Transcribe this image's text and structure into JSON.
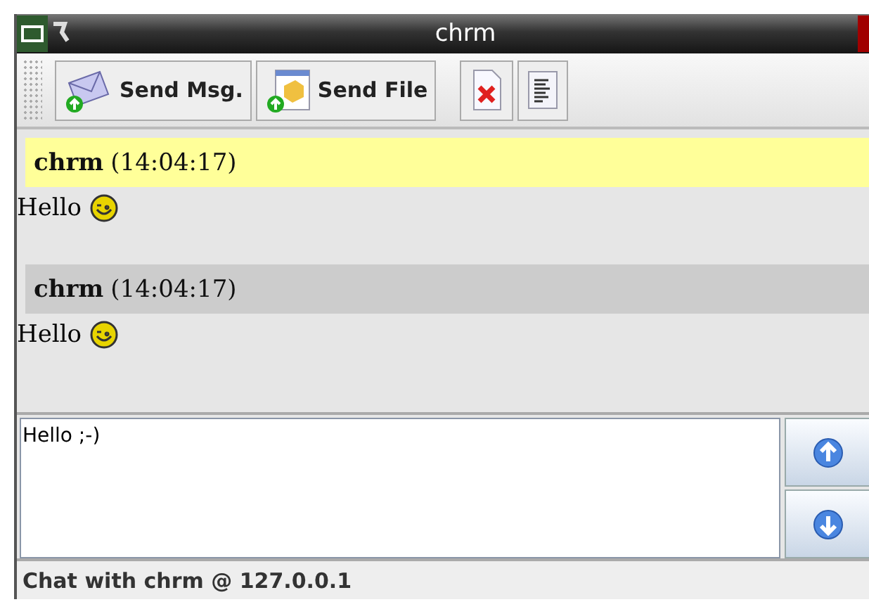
{
  "window": {
    "title": "chrm"
  },
  "toolbar": [
    {
      "kind": "mail",
      "label": "Send Msg."
    },
    {
      "kind": "file",
      "label": "Send File"
    },
    {
      "kind": "clear"
    },
    {
      "kind": "log"
    }
  ],
  "messages": [
    {
      "sender": "chrm",
      "time": "(14:04:17)",
      "text": "Hello",
      "highlighted": true
    },
    {
      "sender": "chrm",
      "time": "(14:04:17)",
      "text": "Hello",
      "highlighted": false
    }
  ],
  "input": {
    "value": "Hello ;-)"
  },
  "status_bar": "Chat with chrm @ 127.0.0.1"
}
